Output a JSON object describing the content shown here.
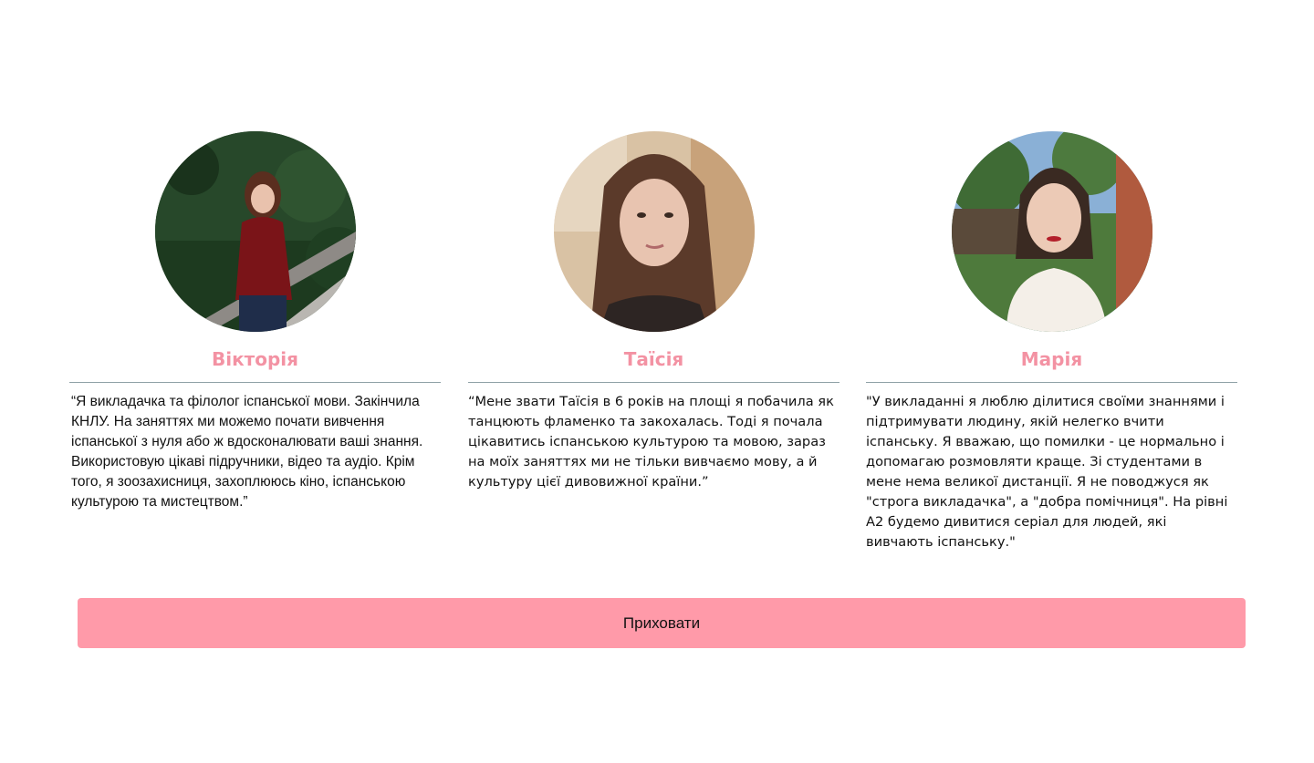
{
  "teachers": [
    {
      "name": "Вікторія",
      "bio": "“Я викладачка та філолог іспанської мови. Закінчила КНЛУ. На заняттях ми можемо почати вивчення іспанської з нуля або ж вдосконалювати ваші знання. Використовую цікаві підручники, відео та аудіо. Крім того, я зоозахисниця, захоплююсь кіно, іспанською культурою та мистецтвом.”"
    },
    {
      "name": "Таїсія",
      "bio": "“Мене звати Таїсія в 6 років на площі я побачила як танцюють фламенко та закохалась. Тоді я почала цікавитись іспанською культурою та мовою, зараз на моїх заняттях ми не тільки вивчаємо мову, а й культуру цієї дивовижної країни.”"
    },
    {
      "name": "Марія",
      "bio": "\"У викладанні я люблю ділитися своїми знаннями і підтримувати людину, якій нелегко вчити іспанську. Я вважаю, що помилки - це нормально і допомагаю розмовляти краще. Зі студентами в мене нема великої дистанції. Я не поводжуся як \"строга викладачка\", а \"добра помічниця\". На рівні А2 будемо дивитися серіал для людей, які вивчають іспанську.\""
    }
  ],
  "hide_button_label": "Приховати",
  "colors": {
    "name_accent": "#f392a3",
    "button_bg": "#ff9aa9",
    "divider": "#8fa1a6"
  }
}
